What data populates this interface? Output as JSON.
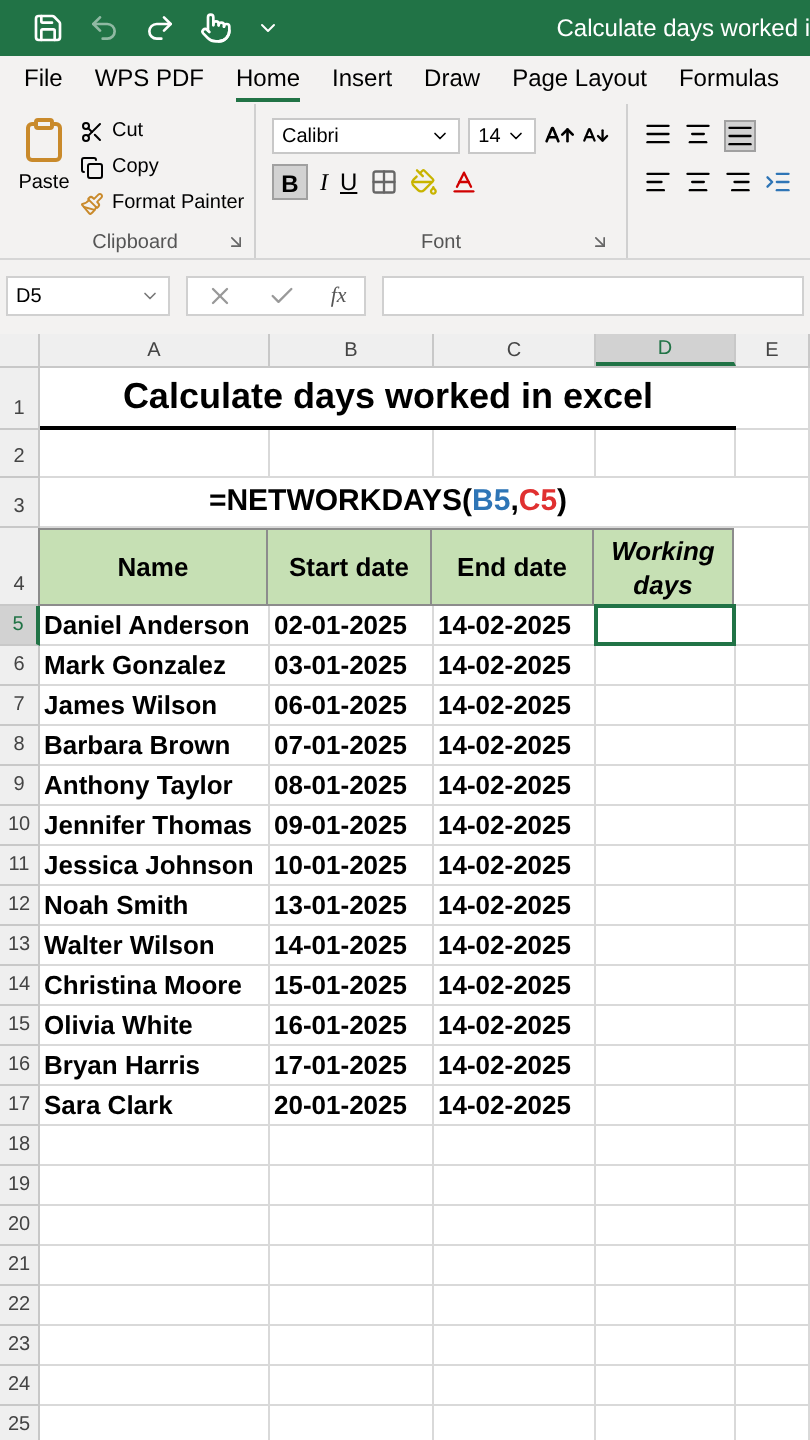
{
  "window": {
    "title": "Calculate days worked i"
  },
  "menu_tabs": [
    {
      "label": "File",
      "selected": false
    },
    {
      "label": "WPS PDF",
      "selected": false
    },
    {
      "label": "Home",
      "selected": true
    },
    {
      "label": "Insert",
      "selected": false
    },
    {
      "label": "Draw",
      "selected": false
    },
    {
      "label": "Page Layout",
      "selected": false
    },
    {
      "label": "Formulas",
      "selected": false
    }
  ],
  "ribbon": {
    "clipboard": {
      "paste": "Paste",
      "cut": "Cut",
      "copy": "Copy",
      "format_painter": "Format Painter",
      "label": "Clipboard"
    },
    "font": {
      "font_name": "Calibri",
      "font_size": "14",
      "bold": "B",
      "italic": "I",
      "underline": "U",
      "bold_on": true,
      "label": "Font"
    }
  },
  "formula_bar": {
    "name_box": "D5",
    "fx": "fx"
  },
  "columns": [
    {
      "label": "A",
      "selected": false
    },
    {
      "label": "B",
      "selected": false
    },
    {
      "label": "C",
      "selected": false
    },
    {
      "label": "D",
      "selected": true
    },
    {
      "label": "E",
      "selected": false
    }
  ],
  "row_numbers": [
    {
      "label": "1",
      "selected": false
    },
    {
      "label": "2",
      "selected": false
    },
    {
      "label": "3",
      "selected": false
    },
    {
      "label": "4",
      "selected": false
    },
    {
      "label": "5",
      "selected": true
    },
    {
      "label": "6",
      "selected": false
    },
    {
      "label": "7",
      "selected": false
    },
    {
      "label": "8",
      "selected": false
    },
    {
      "label": "9",
      "selected": false
    },
    {
      "label": "10",
      "selected": false
    },
    {
      "label": "11",
      "selected": false
    },
    {
      "label": "12",
      "selected": false
    },
    {
      "label": "13",
      "selected": false
    },
    {
      "label": "14",
      "selected": false
    },
    {
      "label": "15",
      "selected": false
    },
    {
      "label": "16",
      "selected": false
    },
    {
      "label": "17",
      "selected": false
    },
    {
      "label": "18",
      "selected": false
    },
    {
      "label": "19",
      "selected": false
    },
    {
      "label": "20",
      "selected": false
    },
    {
      "label": "21",
      "selected": false
    },
    {
      "label": "22",
      "selected": false
    },
    {
      "label": "23",
      "selected": false
    },
    {
      "label": "24",
      "selected": false
    },
    {
      "label": "25",
      "selected": false
    }
  ],
  "sheet": {
    "title": "Calculate days worked in excel",
    "formula": [
      {
        "text": "=NETWORKDAYS(",
        "color": "#000000"
      },
      {
        "text": "B5",
        "color": "#2e75b6"
      },
      {
        "text": ",",
        "color": "#000000"
      },
      {
        "text": "C5",
        "color": "#e03030"
      },
      {
        "text": ")",
        "color": "#000000"
      }
    ],
    "headers": [
      "Name",
      "Start date",
      "End date",
      "Working days"
    ],
    "rows": [
      [
        "Daniel Anderson",
        "02-01-2025",
        "14-02-2025"
      ],
      [
        "Mark Gonzalez",
        "03-01-2025",
        "14-02-2025"
      ],
      [
        "James Wilson",
        "06-01-2025",
        "14-02-2025"
      ],
      [
        "Barbara Brown",
        "07-01-2025",
        "14-02-2025"
      ],
      [
        "Anthony Taylor",
        "08-01-2025",
        "14-02-2025"
      ],
      [
        "Jennifer Thomas",
        "09-01-2025",
        "14-02-2025"
      ],
      [
        "Jessica Johnson",
        "10-01-2025",
        "14-02-2025"
      ],
      [
        "Noah Smith",
        "13-01-2025",
        "14-02-2025"
      ],
      [
        "Walter Wilson",
        "14-01-2025",
        "14-02-2025"
      ],
      [
        "Christina Moore",
        "15-01-2025",
        "14-02-2025"
      ],
      [
        "Olivia White",
        "16-01-2025",
        "14-02-2025"
      ],
      [
        "Bryan Harris",
        "17-01-2025",
        "14-02-2025"
      ],
      [
        "Sara Clark",
        "20-01-2025",
        "14-02-2025"
      ]
    ]
  }
}
